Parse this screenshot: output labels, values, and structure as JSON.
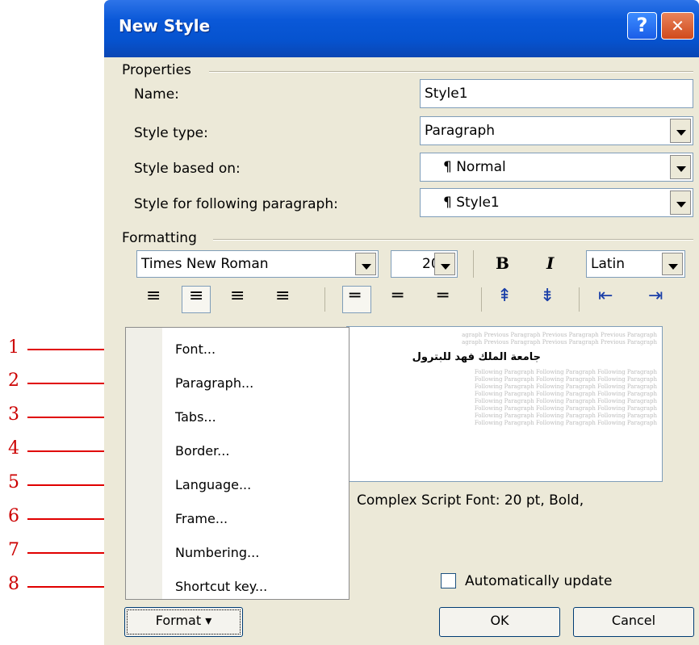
{
  "window": {
    "title": "New Style",
    "help_glyph": "?",
    "close_glyph": "✕"
  },
  "properties": {
    "group_label": "Properties",
    "name_label": "Name:",
    "name_value": "Style1",
    "style_type_label": "Style type:",
    "style_type_value": "Paragraph",
    "based_on_label": "Style based on:",
    "based_on_value": "¶ Normal",
    "following_label": "Style for following paragraph:",
    "following_value": "¶ Style1"
  },
  "formatting": {
    "group_label": "Formatting",
    "font": "Times New Roman",
    "size": "20",
    "bold": "B",
    "italic": "I",
    "script": "Latin"
  },
  "preview": {
    "prev_lines": [
      "agraph Previous Paragraph Previous Paragraph Previous Paragraph",
      "agraph Previous Paragraph Previous Paragraph Previous Paragraph"
    ],
    "arabic_text": "جامعة الملك فهد للبترول",
    "follow_lines": [
      "Following Paragraph Following Paragraph Following Paragraph",
      "Following Paragraph Following Paragraph Following Paragraph",
      "Following Paragraph Following Paragraph Following Paragraph",
      "Following Paragraph Following Paragraph Following Paragraph",
      "Following Paragraph Following Paragraph Following Paragraph",
      "Following Paragraph Following Paragraph Following Paragraph",
      "Following Paragraph Following Paragraph Following Paragraph",
      "Following Paragraph Following Paragraph Following Paragraph"
    ]
  },
  "description": "Complex Script Font: 20 pt, Bold,",
  "format_menu": {
    "items": [
      "Font...",
      "Paragraph...",
      "Tabs...",
      "Border...",
      "Language...",
      "Frame...",
      "Numbering...",
      "Shortcut key..."
    ]
  },
  "auto_update_label": "Automatically update",
  "buttons": {
    "format": "Format ▾",
    "ok": "OK",
    "cancel": "Cancel"
  },
  "callouts": [
    "1",
    "2",
    "3",
    "4",
    "5",
    "6",
    "7",
    "8"
  ],
  "colors": {
    "callout": "#e00000",
    "title_bar": "#0653cf",
    "dialog_bg": "#ece9d8"
  }
}
